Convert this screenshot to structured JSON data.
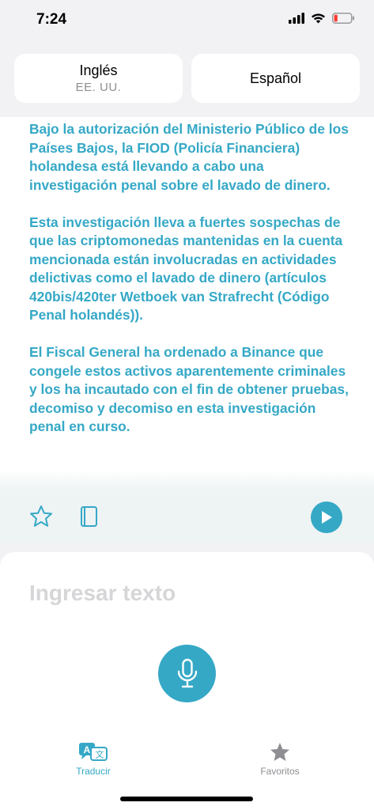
{
  "status": {
    "time": "7:24"
  },
  "languages": {
    "source": {
      "name": "Inglés",
      "region": "EE. UU."
    },
    "target": {
      "name": "Español"
    }
  },
  "translation": {
    "paragraphs": [
      "Bajo la autorización del Ministerio Público de los Países Bajos, la FIOD (Policía Financiera) holandesa está llevando a cabo una investigación penal sobre el lavado de dinero.",
      "Esta investigación lleva a fuertes sospechas de que las criptomonedas mantenidas en la cuenta mencionada están involucradas en actividades delictivas como el lavado de dinero (artículos 420bis/420ter Wetboek van Strafrecht (Código Penal holandés)).",
      "El Fiscal General ha ordenado a Binance que congele estos activos aparentemente criminales y los ha incautado con el fin de obtener pruebas, decomiso y decomiso en esta investigación penal en curso."
    ]
  },
  "input": {
    "placeholder": "Ingresar texto"
  },
  "tabs": {
    "translate": "Traducir",
    "favorites": "Favoritos"
  },
  "colors": {
    "accent": "#35a8c6"
  },
  "icons": {
    "favorite": "star-outline-icon",
    "dictionary": "book-icon",
    "play": "play-icon",
    "mic": "microphone-icon"
  }
}
